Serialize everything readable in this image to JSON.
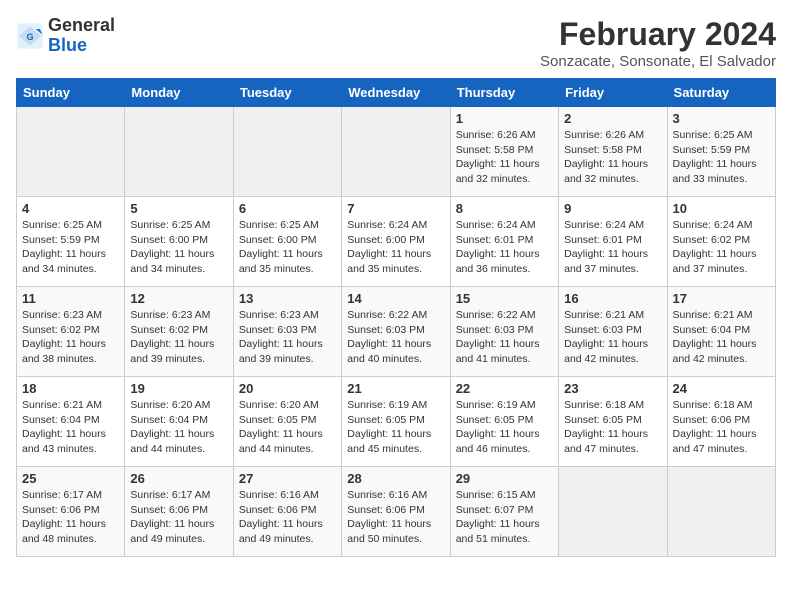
{
  "logo": {
    "text_general": "General",
    "text_blue": "Blue"
  },
  "header": {
    "month": "February 2024",
    "location": "Sonzacate, Sonsonate, El Salvador"
  },
  "weekdays": [
    "Sunday",
    "Monday",
    "Tuesday",
    "Wednesday",
    "Thursday",
    "Friday",
    "Saturday"
  ],
  "weeks": [
    [
      {
        "day": "",
        "info": ""
      },
      {
        "day": "",
        "info": ""
      },
      {
        "day": "",
        "info": ""
      },
      {
        "day": "",
        "info": ""
      },
      {
        "day": "1",
        "info": "Sunrise: 6:26 AM\nSunset: 5:58 PM\nDaylight: 11 hours\nand 32 minutes."
      },
      {
        "day": "2",
        "info": "Sunrise: 6:26 AM\nSunset: 5:58 PM\nDaylight: 11 hours\nand 32 minutes."
      },
      {
        "day": "3",
        "info": "Sunrise: 6:25 AM\nSunset: 5:59 PM\nDaylight: 11 hours\nand 33 minutes."
      }
    ],
    [
      {
        "day": "4",
        "info": "Sunrise: 6:25 AM\nSunset: 5:59 PM\nDaylight: 11 hours\nand 34 minutes."
      },
      {
        "day": "5",
        "info": "Sunrise: 6:25 AM\nSunset: 6:00 PM\nDaylight: 11 hours\nand 34 minutes."
      },
      {
        "day": "6",
        "info": "Sunrise: 6:25 AM\nSunset: 6:00 PM\nDaylight: 11 hours\nand 35 minutes."
      },
      {
        "day": "7",
        "info": "Sunrise: 6:24 AM\nSunset: 6:00 PM\nDaylight: 11 hours\nand 35 minutes."
      },
      {
        "day": "8",
        "info": "Sunrise: 6:24 AM\nSunset: 6:01 PM\nDaylight: 11 hours\nand 36 minutes."
      },
      {
        "day": "9",
        "info": "Sunrise: 6:24 AM\nSunset: 6:01 PM\nDaylight: 11 hours\nand 37 minutes."
      },
      {
        "day": "10",
        "info": "Sunrise: 6:24 AM\nSunset: 6:02 PM\nDaylight: 11 hours\nand 37 minutes."
      }
    ],
    [
      {
        "day": "11",
        "info": "Sunrise: 6:23 AM\nSunset: 6:02 PM\nDaylight: 11 hours\nand 38 minutes."
      },
      {
        "day": "12",
        "info": "Sunrise: 6:23 AM\nSunset: 6:02 PM\nDaylight: 11 hours\nand 39 minutes."
      },
      {
        "day": "13",
        "info": "Sunrise: 6:23 AM\nSunset: 6:03 PM\nDaylight: 11 hours\nand 39 minutes."
      },
      {
        "day": "14",
        "info": "Sunrise: 6:22 AM\nSunset: 6:03 PM\nDaylight: 11 hours\nand 40 minutes."
      },
      {
        "day": "15",
        "info": "Sunrise: 6:22 AM\nSunset: 6:03 PM\nDaylight: 11 hours\nand 41 minutes."
      },
      {
        "day": "16",
        "info": "Sunrise: 6:21 AM\nSunset: 6:03 PM\nDaylight: 11 hours\nand 42 minutes."
      },
      {
        "day": "17",
        "info": "Sunrise: 6:21 AM\nSunset: 6:04 PM\nDaylight: 11 hours\nand 42 minutes."
      }
    ],
    [
      {
        "day": "18",
        "info": "Sunrise: 6:21 AM\nSunset: 6:04 PM\nDaylight: 11 hours\nand 43 minutes."
      },
      {
        "day": "19",
        "info": "Sunrise: 6:20 AM\nSunset: 6:04 PM\nDaylight: 11 hours\nand 44 minutes."
      },
      {
        "day": "20",
        "info": "Sunrise: 6:20 AM\nSunset: 6:05 PM\nDaylight: 11 hours\nand 44 minutes."
      },
      {
        "day": "21",
        "info": "Sunrise: 6:19 AM\nSunset: 6:05 PM\nDaylight: 11 hours\nand 45 minutes."
      },
      {
        "day": "22",
        "info": "Sunrise: 6:19 AM\nSunset: 6:05 PM\nDaylight: 11 hours\nand 46 minutes."
      },
      {
        "day": "23",
        "info": "Sunrise: 6:18 AM\nSunset: 6:05 PM\nDaylight: 11 hours\nand 47 minutes."
      },
      {
        "day": "24",
        "info": "Sunrise: 6:18 AM\nSunset: 6:06 PM\nDaylight: 11 hours\nand 47 minutes."
      }
    ],
    [
      {
        "day": "25",
        "info": "Sunrise: 6:17 AM\nSunset: 6:06 PM\nDaylight: 11 hours\nand 48 minutes."
      },
      {
        "day": "26",
        "info": "Sunrise: 6:17 AM\nSunset: 6:06 PM\nDaylight: 11 hours\nand 49 minutes."
      },
      {
        "day": "27",
        "info": "Sunrise: 6:16 AM\nSunset: 6:06 PM\nDaylight: 11 hours\nand 49 minutes."
      },
      {
        "day": "28",
        "info": "Sunrise: 6:16 AM\nSunset: 6:06 PM\nDaylight: 11 hours\nand 50 minutes."
      },
      {
        "day": "29",
        "info": "Sunrise: 6:15 AM\nSunset: 6:07 PM\nDaylight: 11 hours\nand 51 minutes."
      },
      {
        "day": "",
        "info": ""
      },
      {
        "day": "",
        "info": ""
      }
    ]
  ]
}
